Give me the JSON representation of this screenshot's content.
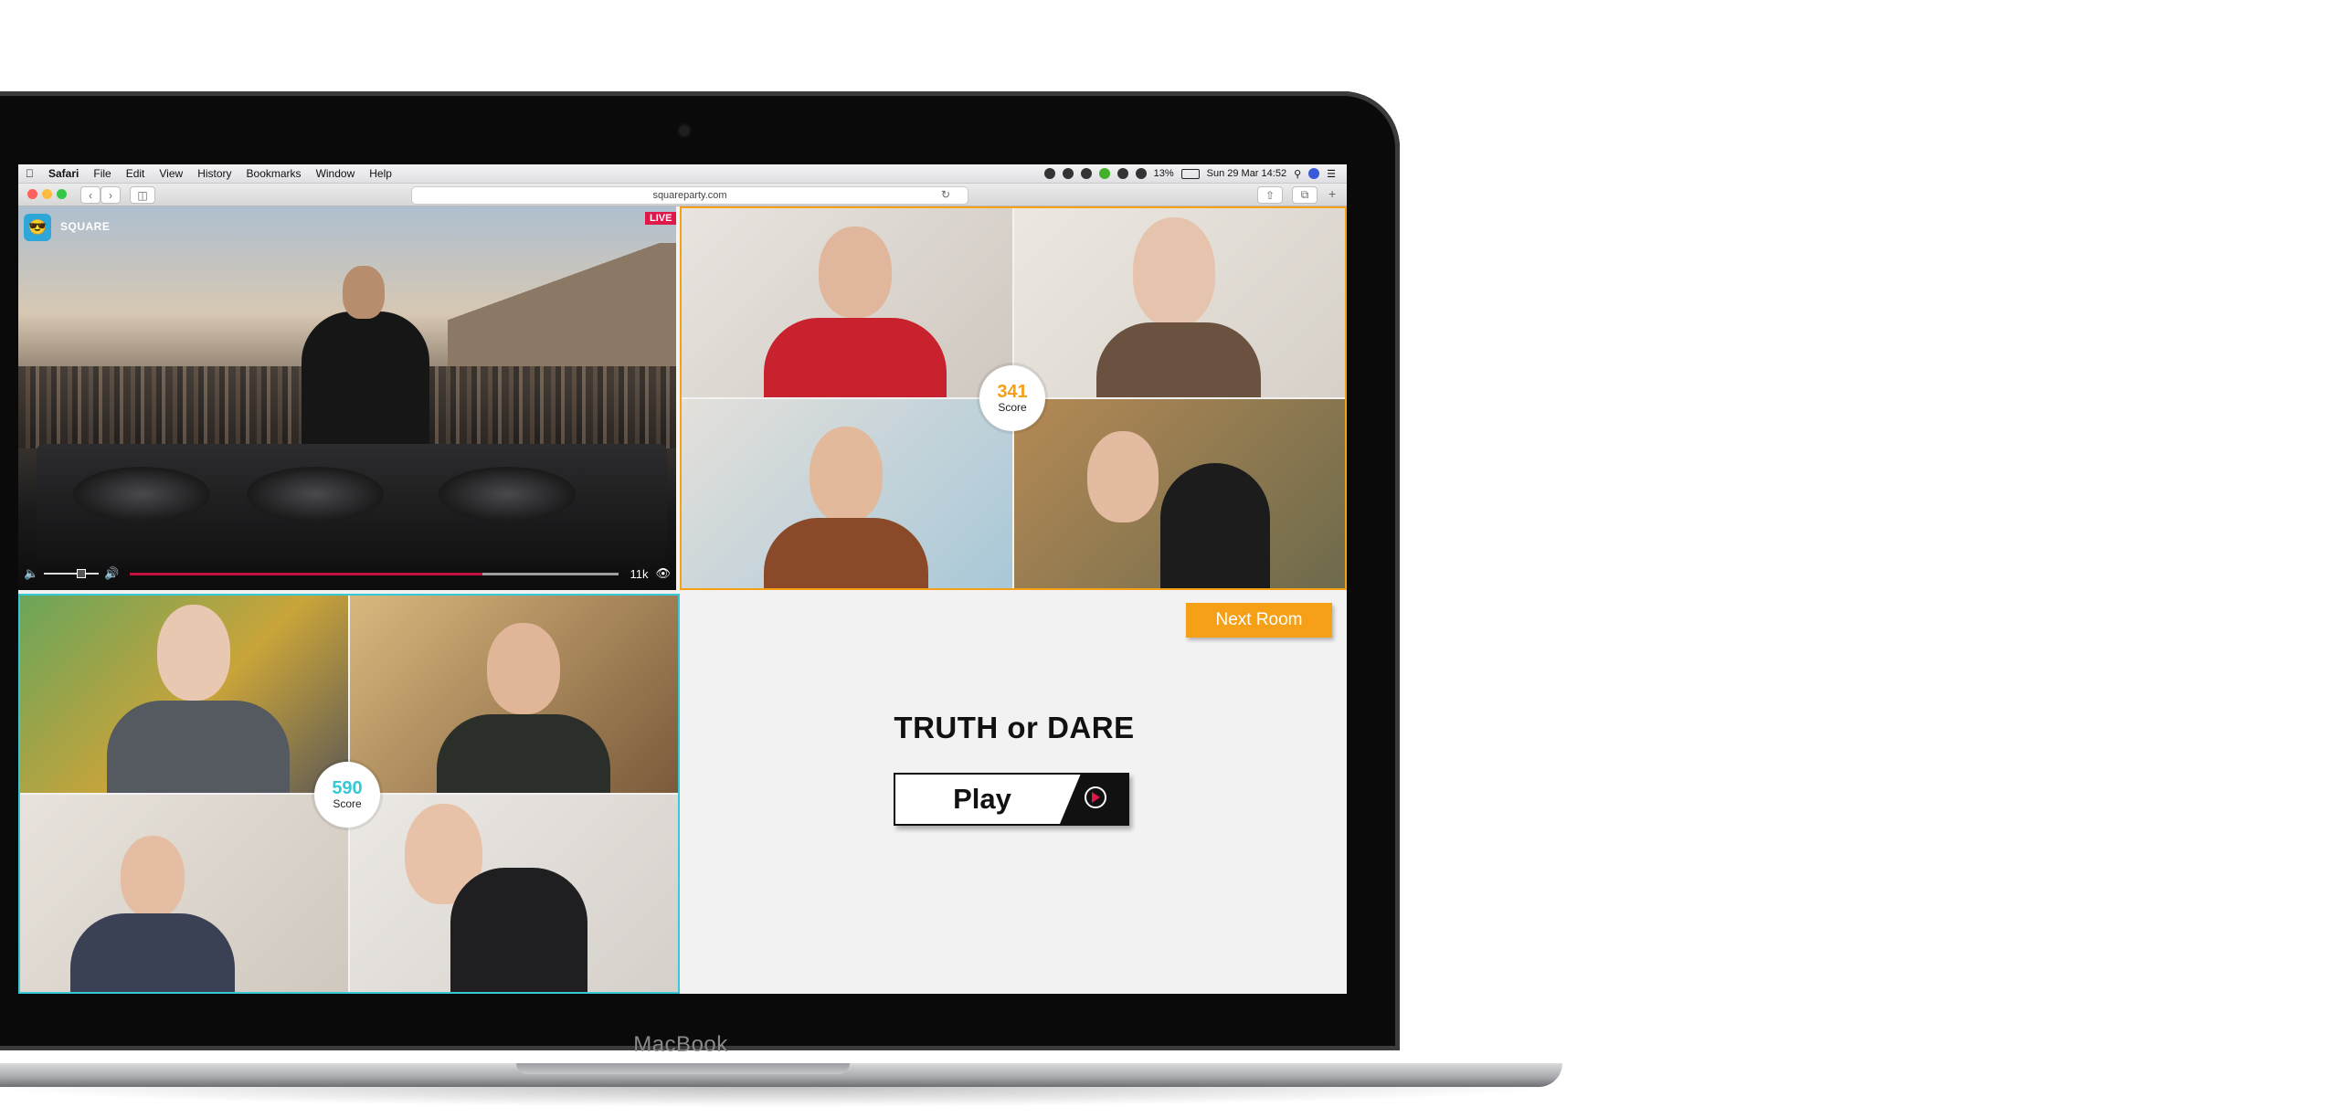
{
  "device": {
    "chin_label": "MacBook"
  },
  "menubar": {
    "apple": "",
    "app": "Safari",
    "items": [
      "File",
      "Edit",
      "View",
      "History",
      "Bookmarks",
      "Window",
      "Help"
    ],
    "battery": "13%",
    "datetime": "Sun 29 Mar  14:52"
  },
  "browser": {
    "url": "squareparty.com"
  },
  "brand": {
    "name": "SQUARE"
  },
  "stream": {
    "live_label": "LIVE",
    "viewers": "11k",
    "progress": 0.72
  },
  "groups": [
    {
      "score": "341",
      "score_label": "Score",
      "color": "#f5a017"
    },
    {
      "score": "590",
      "score_label": "Score",
      "color": "#37c9d6"
    }
  ],
  "game": {
    "next_room_label": "Next Room",
    "title": "TRUTH or DARE",
    "play_label": "Play"
  },
  "colors": {
    "accent": "#f5a017",
    "cyan": "#37c9d6",
    "live": "#e0174b"
  }
}
